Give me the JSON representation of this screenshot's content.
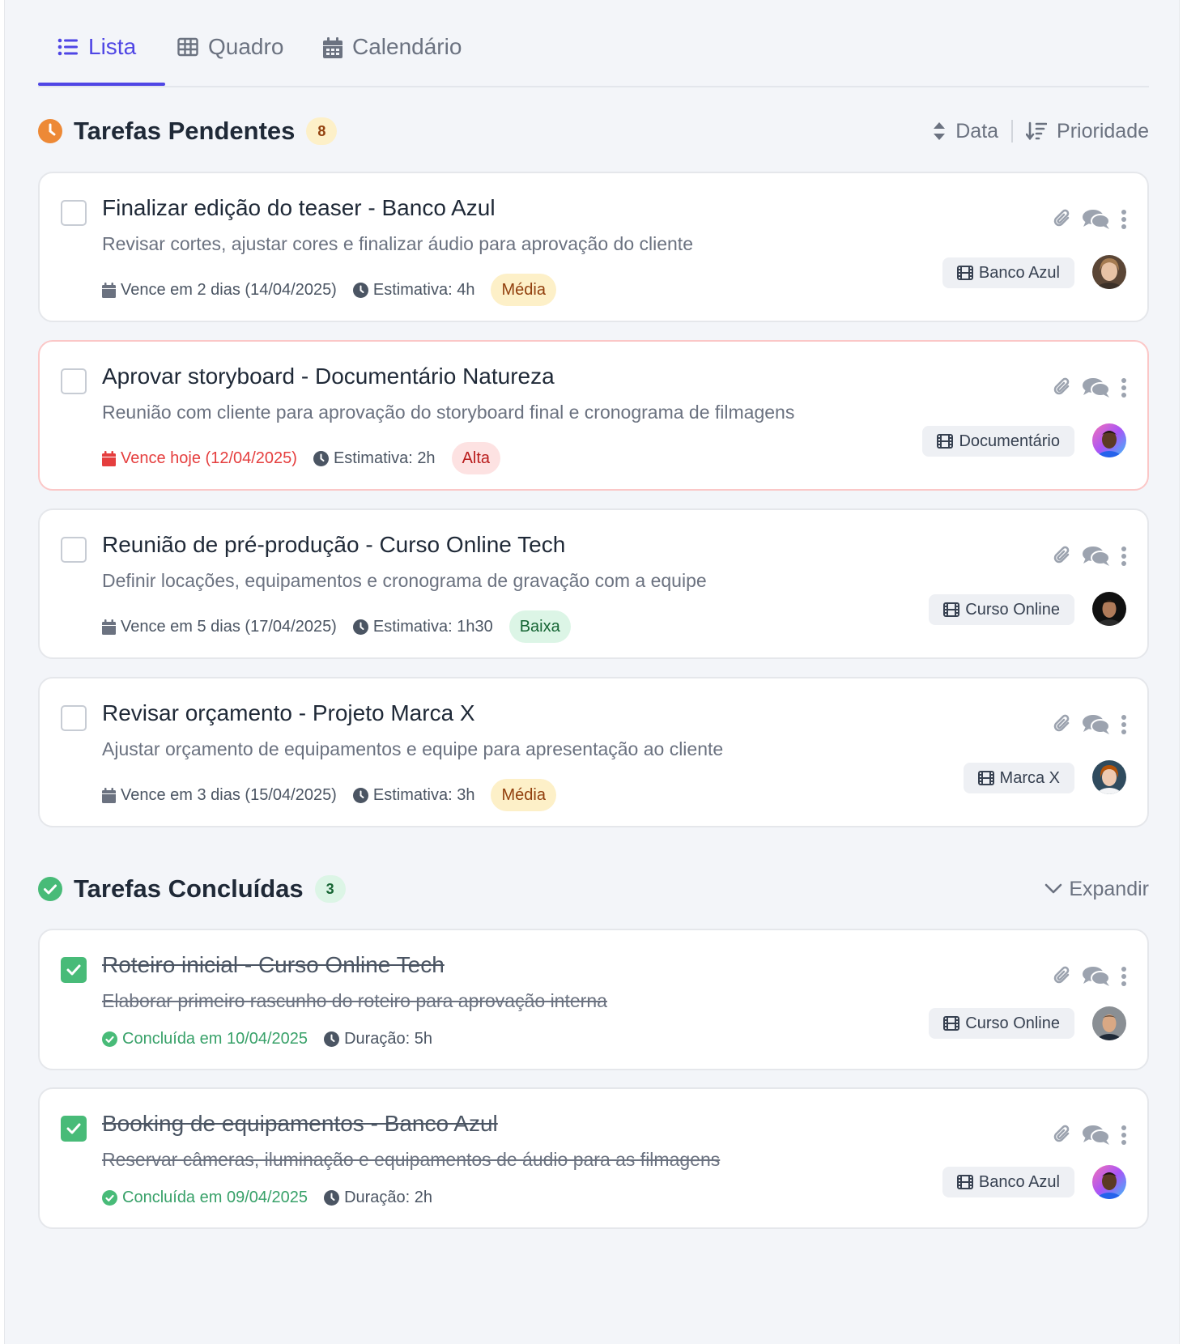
{
  "tabs": [
    {
      "label": "Lista",
      "icon": "list-icon",
      "active": true
    },
    {
      "label": "Quadro",
      "icon": "table-icon"
    },
    {
      "label": "Calendário",
      "icon": "calendar-icon"
    }
  ],
  "pending": {
    "title": "Tarefas Pendentes",
    "count": "8",
    "sort_date": "Data",
    "sort_priority": "Prioridade"
  },
  "completed": {
    "title": "Tarefas Concluídas",
    "count": "3",
    "expand": "Expandir"
  },
  "pending_tasks": [
    {
      "title": "Finalizar edição do teaser - Banco Azul",
      "description": "Revisar cortes, ajustar cores e finalizar áudio para aprovação do cliente",
      "due": "Vence em 2 dias (14/04/2025)",
      "estimate": "Estimativa: 4h",
      "priority": "Média",
      "project": "Banco Azul"
    },
    {
      "title": "Aprovar storyboard - Documentário Natureza",
      "description": "Reunião com cliente para aprovação do storyboard final e cronograma de filmagens",
      "due": "Vence hoje (12/04/2025)",
      "estimate": "Estimativa: 2h",
      "priority": "Alta",
      "project": "Documentário"
    },
    {
      "title": "Reunião de pré-produção - Curso Online Tech",
      "description": "Definir locações, equipamentos e cronograma de gravação com a equipe",
      "due": "Vence em 5 dias (17/04/2025)",
      "estimate": "Estimativa: 1h30",
      "priority": "Baixa",
      "project": "Curso Online"
    },
    {
      "title": "Revisar orçamento - Projeto Marca X",
      "description": "Ajustar orçamento de equipamentos e equipe para apresentação ao cliente",
      "due": "Vence em 3 dias (15/04/2025)",
      "estimate": "Estimativa: 3h",
      "priority": "Média",
      "project": "Marca X"
    }
  ],
  "completed_tasks": [
    {
      "title": "Roteiro inicial - Curso Online Tech",
      "description": "Elaborar primeiro rascunho do roteiro para aprovação interna",
      "completed": "Concluída em 10/04/2025",
      "duration": "Duração: 5h",
      "project": "Curso Online"
    },
    {
      "title": "Booking de equipamentos - Banco Azul",
      "description": "Reservar câmeras, iluminação e equipamentos de áudio para as filmagens",
      "completed": "Concluída em 09/04/2025",
      "duration": "Duração: 2h",
      "project": "Banco Azul"
    }
  ],
  "colors": {
    "accent": "#4f46e5",
    "pending": "#ed8936",
    "done": "#48bb78",
    "urgent": "#e53e3e"
  }
}
